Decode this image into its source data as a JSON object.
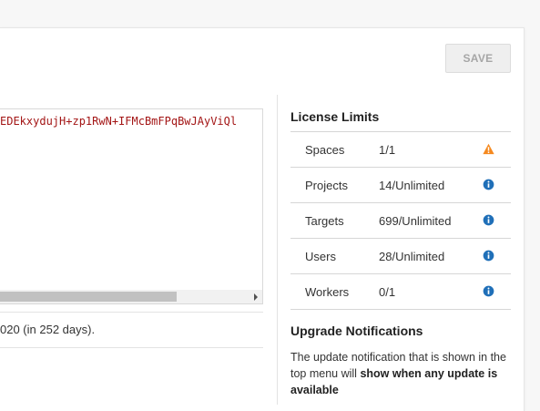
{
  "toolbar": {
    "save_label": "SAVE"
  },
  "license": {
    "key_text": "EDEkxydujH+zp1RwN+IFMcBmFPqBwJAyViQl",
    "expiry_text": "020 (in 252 days)."
  },
  "limits": {
    "title": "License Limits",
    "rows": [
      {
        "name": "Spaces",
        "value": "1/1",
        "icon": "warning-icon",
        "icon_color": "#f5891f"
      },
      {
        "name": "Projects",
        "value": "14/Unlimited",
        "icon": "info-icon",
        "icon_color": "#1f6fb8"
      },
      {
        "name": "Targets",
        "value": "699/Unlimited",
        "icon": "info-icon",
        "icon_color": "#1f6fb8"
      },
      {
        "name": "Users",
        "value": "28/Unlimited",
        "icon": "info-icon",
        "icon_color": "#1f6fb8"
      },
      {
        "name": "Workers",
        "value": "0/1",
        "icon": "info-icon",
        "icon_color": "#1f6fb8"
      }
    ]
  },
  "upgrade": {
    "title": "Upgrade Notifications",
    "text_prefix": "The update notification that is shown in the top menu will ",
    "text_bold": "show when any update is available"
  }
}
